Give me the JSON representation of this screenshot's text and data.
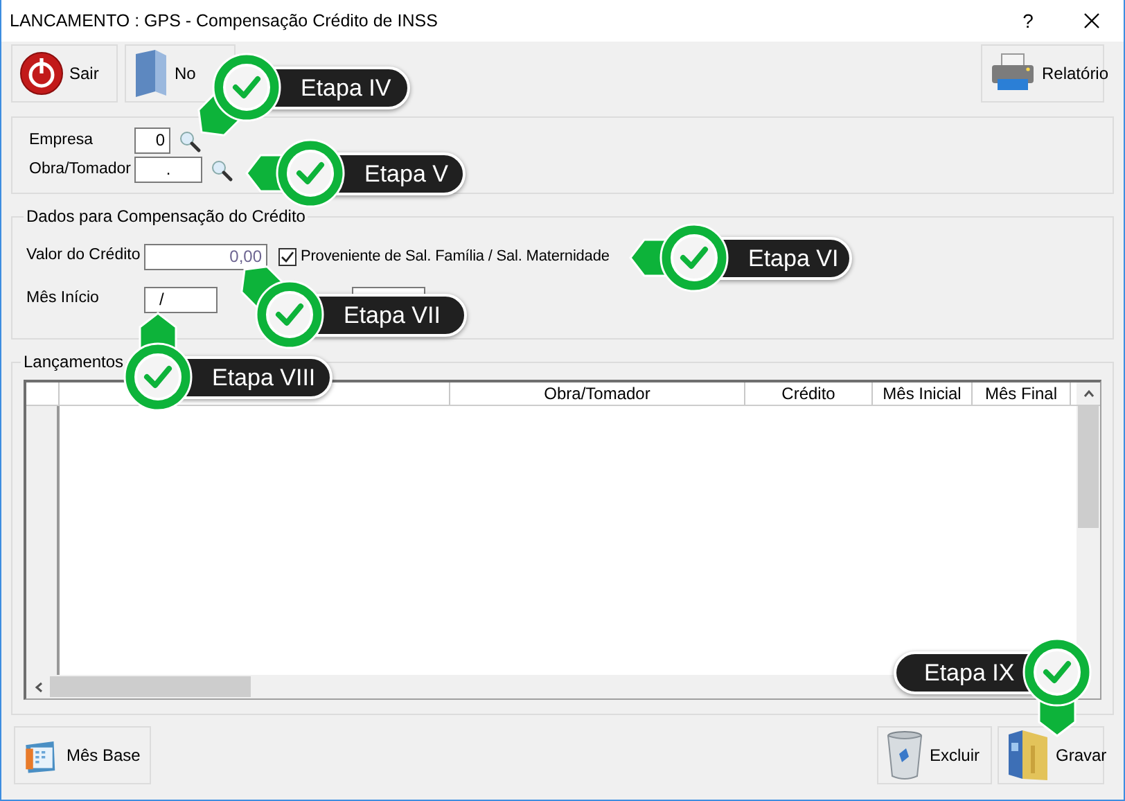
{
  "window": {
    "title": "LANCAMENTO : GPS - Compensação Crédito de INSS",
    "help": "?"
  },
  "toolbar": [
    {
      "label": "Sair"
    },
    {
      "label": "No"
    }
  ],
  "report_button": {
    "label": "Relatório"
  },
  "header_fields": [
    {
      "label": "Empresa",
      "value": "0"
    },
    {
      "label": "Obra/Tomador",
      "value": "."
    }
  ],
  "credit_group": {
    "title": "Dados para Compensação do Crédito",
    "valor_label": "Valor do Crédito",
    "valor": "0,00",
    "checkbox": {
      "label": "Proveniente de Sal. Família / Sal. Maternidade",
      "checked": true
    },
    "inicio_label": "Mês Início",
    "inicio": "/"
  },
  "lancamentos": {
    "title": "Lançamentos",
    "columns": [
      "Obra/Tomador",
      "Crédito",
      "Mês Inicial",
      "Mês Final"
    ]
  },
  "footer_left": [
    {
      "label": "Mês Base"
    }
  ],
  "footer_right": [
    {
      "label": "Excluir"
    },
    {
      "label": "Gravar"
    }
  ],
  "callouts": [
    {
      "label": "Etapa IV"
    },
    {
      "label": "Etapa V"
    },
    {
      "label": "Etapa VI"
    },
    {
      "label": "Etapa VII"
    },
    {
      "label": "Etapa VIII"
    },
    {
      "label": "Etapa IX"
    }
  ]
}
